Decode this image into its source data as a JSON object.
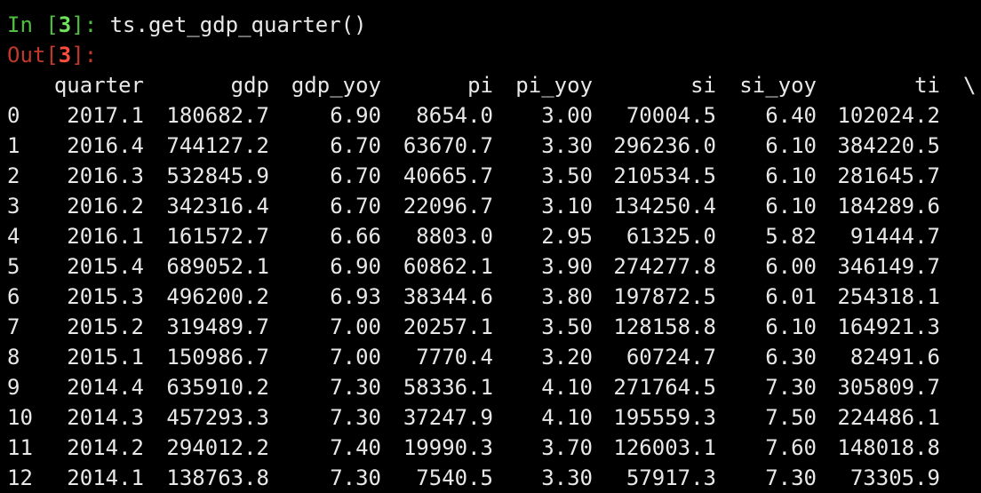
{
  "input_prompt": {
    "prefix": "In [",
    "number": "3",
    "suffix": "]: "
  },
  "command": "ts.get_gdp_quarter()",
  "output_prompt": {
    "prefix": "Out[",
    "number": "3",
    "suffix": "]:"
  },
  "table": {
    "headers": [
      "quarter",
      "gdp",
      "gdp_yoy",
      "pi",
      "pi_yoy",
      "si",
      "si_yoy",
      "ti"
    ],
    "continuation": "\\",
    "rows": [
      [
        "0",
        "2017.1",
        "180682.7",
        "6.90",
        "8654.0",
        "3.00",
        "70004.5",
        "6.40",
        "102024.2"
      ],
      [
        "1",
        "2016.4",
        "744127.2",
        "6.70",
        "63670.7",
        "3.30",
        "296236.0",
        "6.10",
        "384220.5"
      ],
      [
        "2",
        "2016.3",
        "532845.9",
        "6.70",
        "40665.7",
        "3.50",
        "210534.5",
        "6.10",
        "281645.7"
      ],
      [
        "3",
        "2016.2",
        "342316.4",
        "6.70",
        "22096.7",
        "3.10",
        "134250.4",
        "6.10",
        "184289.6"
      ],
      [
        "4",
        "2016.1",
        "161572.7",
        "6.66",
        "8803.0",
        "2.95",
        "61325.0",
        "5.82",
        "91444.7"
      ],
      [
        "5",
        "2015.4",
        "689052.1",
        "6.90",
        "60862.1",
        "3.90",
        "274277.8",
        "6.00",
        "346149.7"
      ],
      [
        "6",
        "2015.3",
        "496200.2",
        "6.93",
        "38344.6",
        "3.80",
        "197872.5",
        "6.01",
        "254318.1"
      ],
      [
        "7",
        "2015.2",
        "319489.7",
        "7.00",
        "20257.1",
        "3.50",
        "128158.8",
        "6.10",
        "164921.3"
      ],
      [
        "8",
        "2015.1",
        "150986.7",
        "7.00",
        "7770.4",
        "3.20",
        "60724.7",
        "6.30",
        "82491.6"
      ],
      [
        "9",
        "2014.4",
        "635910.2",
        "7.30",
        "58336.1",
        "4.10",
        "271764.5",
        "7.30",
        "305809.7"
      ],
      [
        "10",
        "2014.3",
        "457293.3",
        "7.30",
        "37247.9",
        "4.10",
        "195559.3",
        "7.50",
        "224486.1"
      ],
      [
        "11",
        "2014.2",
        "294012.2",
        "7.40",
        "19990.3",
        "3.70",
        "126003.1",
        "7.60",
        "148018.8"
      ],
      [
        "12",
        "2014.1",
        "138763.8",
        "7.30",
        "7540.5",
        "3.30",
        "57917.3",
        "7.30",
        "73305.9"
      ]
    ]
  },
  "colors": {
    "background": "#000000",
    "text": "#e8e8e8",
    "input_prompt": "#4fbf3f",
    "output_prompt": "#c0392b"
  }
}
